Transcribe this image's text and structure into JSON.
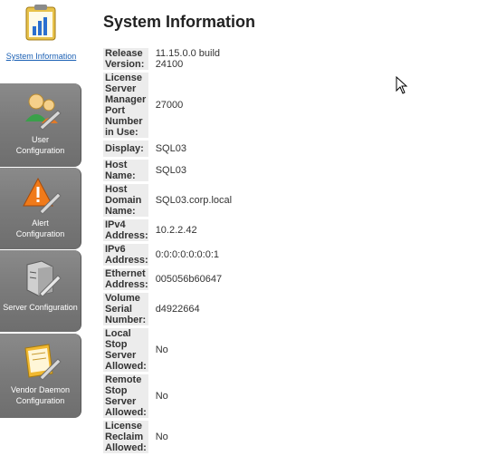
{
  "sidebar": {
    "active": {
      "label": "System Information",
      "icon": "system-info-chart-icon"
    },
    "items": [
      {
        "label1": "User",
        "label2": "Configuration",
        "icon": "user-config-icon"
      },
      {
        "label1": "Alert",
        "label2": "Configuration",
        "icon": "alert-config-icon"
      },
      {
        "label1": "Server Configuration",
        "label2": "",
        "icon": "server-config-icon"
      },
      {
        "label1": "Vendor Daemon",
        "label2": "Configuration",
        "icon": "vendor-daemon-config-icon"
      }
    ]
  },
  "main": {
    "title": "System Information",
    "rows": [
      {
        "key": "Release Version:",
        "value": "11.15.0.0 build 24100"
      },
      {
        "key": "License Server Manager Port Number in Use:",
        "value": "27000"
      },
      {
        "key": "Display:",
        "value": "SQL03"
      },
      {
        "key": "Host Name:",
        "value": "SQL03"
      },
      {
        "key": "Host Domain Name:",
        "value": "SQL03.corp.local"
      },
      {
        "key": "IPv4 Address:",
        "value": "10.2.2.42"
      },
      {
        "key": "IPv6 Address:",
        "value": "0:0:0:0:0:0:0:1"
      },
      {
        "key": "Ethernet Address:",
        "value": "005056b60647"
      },
      {
        "key": "Volume Serial Number:",
        "value": "d4922664"
      },
      {
        "key": "Local Stop Server Allowed:",
        "value": "No"
      },
      {
        "key": "Remote Stop Server Allowed:",
        "value": "No"
      },
      {
        "key": "License Reclaim Allowed:",
        "value": "No"
      }
    ]
  }
}
